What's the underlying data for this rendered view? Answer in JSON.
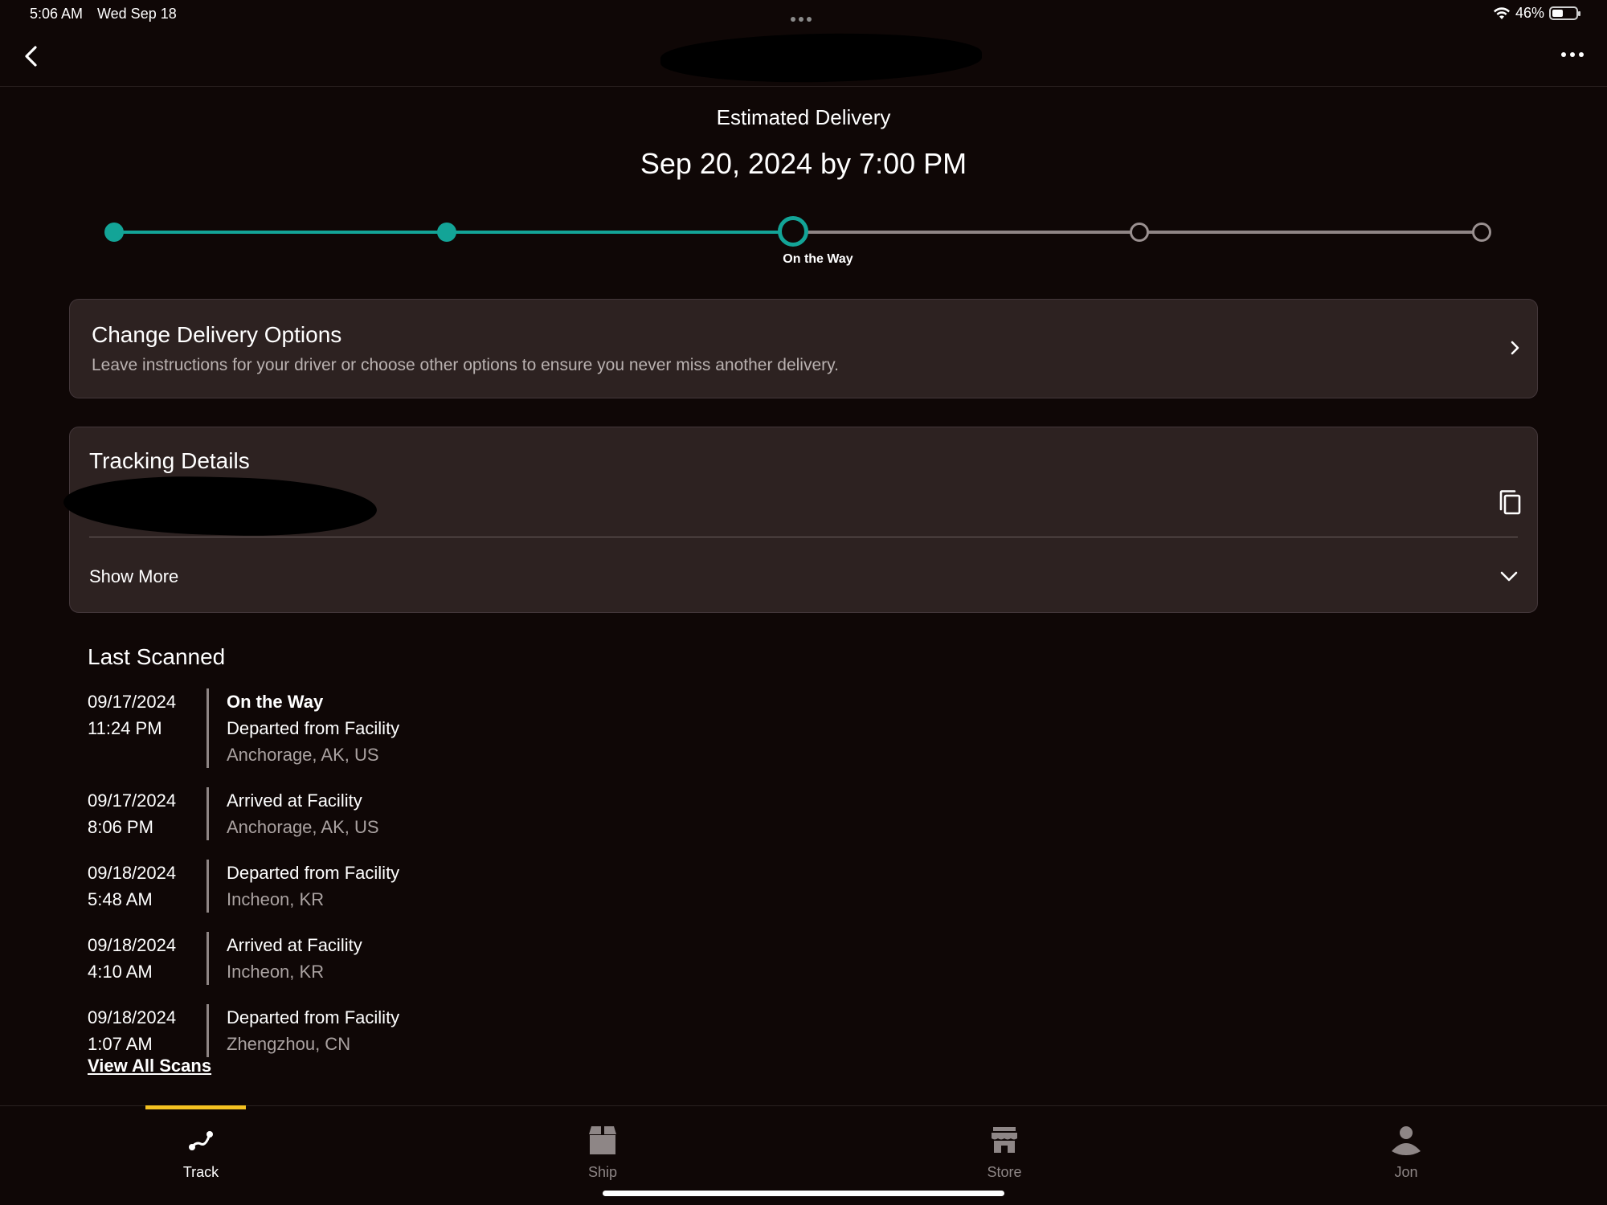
{
  "status_bar": {
    "time": "5:06 AM",
    "date": "Wed Sep 18",
    "battery": "46%"
  },
  "delivery": {
    "label": "Estimated Delivery",
    "date": "Sep 20, 2024 by 7:00 PM",
    "progress": {
      "current_step_label": "On the Way",
      "current_step_index": 2,
      "total_steps": 5
    }
  },
  "delivery_options": {
    "title": "Change Delivery Options",
    "description": "Leave instructions for your driver or choose other options to ensure you never miss another delivery."
  },
  "tracking_details": {
    "title": "Tracking Details",
    "show_more": "Show More"
  },
  "last_scanned": {
    "title": "Last Scanned",
    "scans": [
      {
        "date": "09/17/2024",
        "time": "11:24 PM",
        "status": "On the Way",
        "event": "Departed from Facility",
        "location": "Anchorage, AK, US"
      },
      {
        "date": "09/17/2024",
        "time": "8:06 PM",
        "event": "Arrived at Facility",
        "location": "Anchorage, AK, US"
      },
      {
        "date": "09/18/2024",
        "time": "5:48 AM",
        "event": "Departed from Facility",
        "location": "Incheon, KR"
      },
      {
        "date": "09/18/2024",
        "time": "4:10 AM",
        "event": "Arrived at Facility",
        "location": "Incheon, KR"
      },
      {
        "date": "09/18/2024",
        "time": "1:07 AM",
        "event": "Departed from Facility",
        "location": "Zhengzhou, CN"
      }
    ],
    "view_all": "View All Scans"
  },
  "tabbar": {
    "tabs": [
      {
        "label": "Track",
        "icon": "track-route-icon",
        "active": true
      },
      {
        "label": "Ship",
        "icon": "package-box-icon",
        "active": false
      },
      {
        "label": "Store",
        "icon": "store-front-icon",
        "active": false
      },
      {
        "label": "Jon",
        "icon": "person-icon",
        "active": false
      }
    ]
  },
  "colors": {
    "background": "#0f0706",
    "card": "#2d2221",
    "accent_teal": "#13a497",
    "tab_indicator": "#f4c121"
  }
}
